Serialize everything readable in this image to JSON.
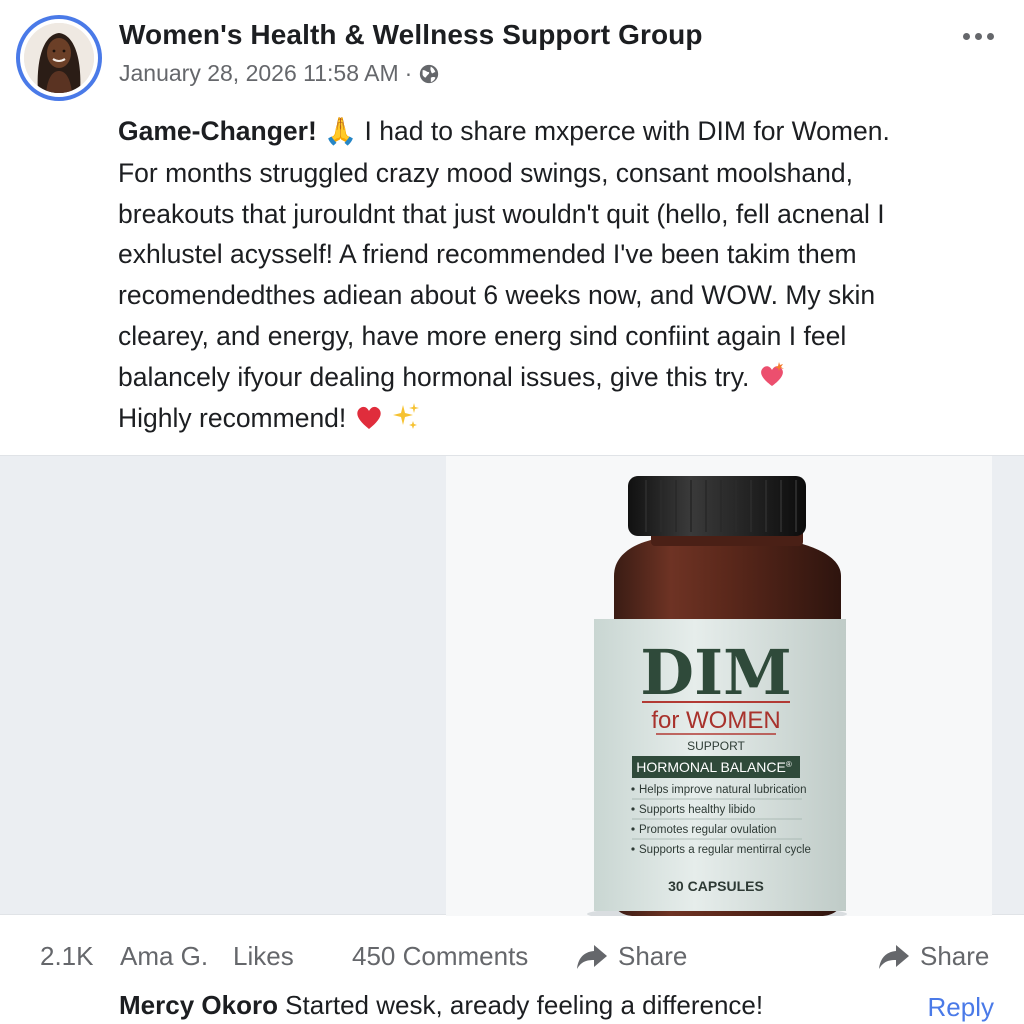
{
  "post": {
    "group_name": "Women's Health & Wellness Support Group",
    "timestamp": "January 28, 2026 11:58 AM",
    "separator": "·",
    "audience_icon": "globe-icon",
    "more_icon": "more-options-icon",
    "accent_color": "#4a7ae8",
    "body": {
      "lead": "Game-Changer!",
      "line1_rest": " I had to share mxperce with DIM for Women.",
      "line2": "For months struggled crazy mood swings, consant moolshand,",
      "line3": "breakouts that jurouldnt that just wouldn't quit (hello, fell acnenal I",
      "line4": "exhlustel acysself! A friend recommended I've been takim them",
      "line5": "recomendedthes adiean about 6 weeks now, and WOW. My skin",
      "line6": "clearey, and energy, have more energ sind confiint again I feel",
      "line7": "balancely ifyour dealing hormonal issues, give this try.",
      "line8": "Highly recommend!",
      "emojis": [
        "folded-hands",
        "sparkling-heart",
        "red-heart",
        "sparkles"
      ]
    }
  },
  "product_image": {
    "brand": "DIM",
    "subtitle": "for WOMEN",
    "support": "SUPPORT",
    "banner": "HORMONAL BALANCE",
    "banner_mark": "®",
    "bullets": [
      "Helps improve natural lubrication",
      "Supports healthy libido",
      "Promotes regular ovulation",
      "Supports a regular mentirral cycle"
    ],
    "count": "30 CAPSULES"
  },
  "actions": {
    "reactions_count": "2.1K",
    "reactor": "Ama G.",
    "likes_label": "Likes",
    "comments_label": "450 Comments",
    "share_label": "Share",
    "share_label_right": "Share"
  },
  "comment": {
    "author": "Mercy Okoro",
    "text": " Started wesk, aready feeling a difference!",
    "reply_label": "Reply"
  }
}
